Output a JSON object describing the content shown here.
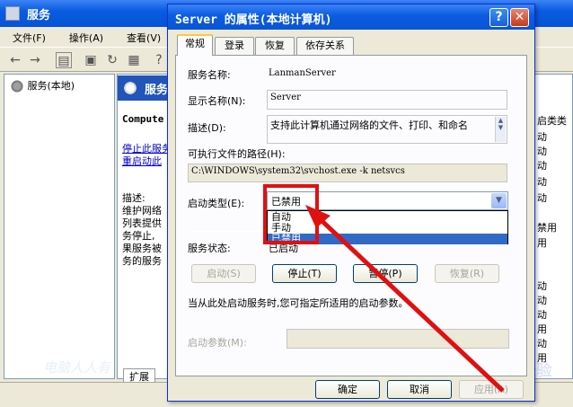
{
  "bg": {
    "title": "服务",
    "menu": [
      "文件(F)",
      "操作(A)",
      "查看(V)"
    ],
    "tree_node": "服务(本地)",
    "pane_header": "服务",
    "pane_text": {
      "computer": "Compute",
      "stop": "停止此服务",
      "restart": "重启动此",
      "desc_label": "描述:",
      "desc_lines": [
        "维护网络",
        "列表提供",
        "务停止,",
        "果服务被",
        "务的服务"
      ]
    },
    "right_col": [
      "启类类",
      "动",
      "动",
      "动",
      "动",
      "动",
      "禁用",
      "用",
      "",
      "",
      "动",
      "动",
      "动",
      "用",
      "动",
      "用",
      "动"
    ],
    "bottom_tab": "扩展",
    "watermark": "电脑人人有"
  },
  "dialog": {
    "title": "Server 的属性(本地计算机)",
    "help": "?",
    "close": "✕",
    "tabs": [
      "常规",
      "登录",
      "恢复",
      "依存关系"
    ],
    "service_name_label": "服务名称:",
    "service_name": "LanmanServer",
    "display_name_label": "显示名称(N):",
    "display_name": "Server",
    "desc_label": "描述(D):",
    "desc": "支持此计算机通过网络的文件、打印、和命名",
    "path_label": "可执行文件的路径(H):",
    "path": "C:\\WINDOWS\\system32\\svchost.exe -k netsvcs",
    "startup_label": "启动类型(E):",
    "startup_value": "已禁用",
    "startup_options": [
      "自动",
      "手动",
      "已禁用"
    ],
    "status_label": "服务状态:",
    "status_value": "已启动",
    "btn_start": "启动(S)",
    "btn_stop": "停止(T)",
    "btn_pause": "暂停(P)",
    "btn_resume": "恢复(R)",
    "hint": "当从此处启动服务时,您可指定所适用的启动参数。",
    "params_label": "启动参数(M):",
    "ok": "确定",
    "cancel": "取消",
    "apply": "应用(A)"
  },
  "watermark_right": "Baidu 经验",
  "colors": {
    "annotation": "#e01010",
    "titlebar": "#0a5ce0",
    "selection": "#316ac5"
  }
}
